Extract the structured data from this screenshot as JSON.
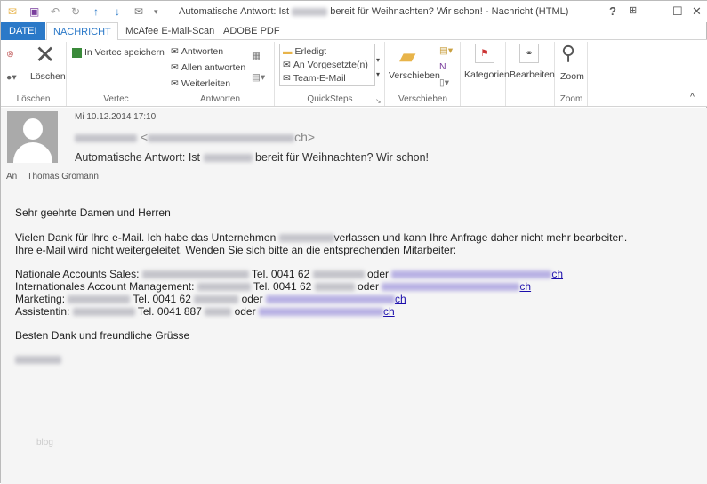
{
  "window": {
    "title_prefix": "Automatische Antwort: Ist",
    "title_suffix": "bereit für Weihnachten? Wir schon! - Nachricht (HTML)",
    "help": "?",
    "minimize": "—",
    "maximize": "☐",
    "close": "✕"
  },
  "tabs": [
    "DATEI",
    "NACHRICHT",
    "McAfee E-Mail-Scan",
    "ADOBE PDF"
  ],
  "ribbon": {
    "loeschen": {
      "delete": "Löschen",
      "group": "Löschen"
    },
    "vertec": {
      "save": "In Vertec speichern",
      "group": "Vertec"
    },
    "antworten": {
      "reply": "Antworten",
      "reply_all": "Allen antworten",
      "forward": "Weiterleiten",
      "group": "Antworten"
    },
    "quicksteps": {
      "items": [
        "Erledigt",
        "An Vorgesetzte(n)",
        "Team-E-Mail"
      ],
      "group": "QuickSteps"
    },
    "verschieben": {
      "move": "Verschieben",
      "group": "Verschieben"
    },
    "kategorien": {
      "label": "Kategorien"
    },
    "bearbeiten": {
      "label": "Bearbeiten"
    },
    "zoom": {
      "label": "Zoom",
      "group": "Zoom"
    }
  },
  "message": {
    "date": "Mi 10.12.2014 17:10",
    "from_suffix": "ch>",
    "from_open": "<",
    "subject_prefix": "Automatische Antwort: Ist",
    "subject_suffix": "bereit für Weihnachten? Wir schon!",
    "to_label": "An",
    "to": "Thomas Gromann"
  },
  "body": {
    "greeting": "Sehr geehrte Damen und Herren",
    "p1a": "Vielen Dank für Ihre e-Mail. Ich habe das Unternehmen",
    "p1b": "verlassen und kann Ihre Anfrage daher nicht mehr bearbeiten.",
    "p2": "Ihre e-Mail wird nicht weitergeleitet. Wenden Sie sich bitte an die entsprechenden Mitarbeiter:",
    "contacts": [
      {
        "label": "Nationale Accounts Sales:",
        "tel": "Tel. 0041 62",
        "oder": "oder",
        "link": "ch"
      },
      {
        "label": "Internationales Account Management:",
        "tel": "Tel. 0041 62",
        "oder": "oder",
        "link": "ch"
      },
      {
        "label": "Marketing:",
        "tel": "Tel. 0041 62",
        "oder": "oder",
        "link": "ch"
      },
      {
        "label": "Assistentin:",
        "tel": "Tel. 0041 887",
        "oder": "oder",
        "link": "ch"
      }
    ],
    "closing": "Besten Dank und freundliche Grüsse",
    "watermark": "blog"
  }
}
